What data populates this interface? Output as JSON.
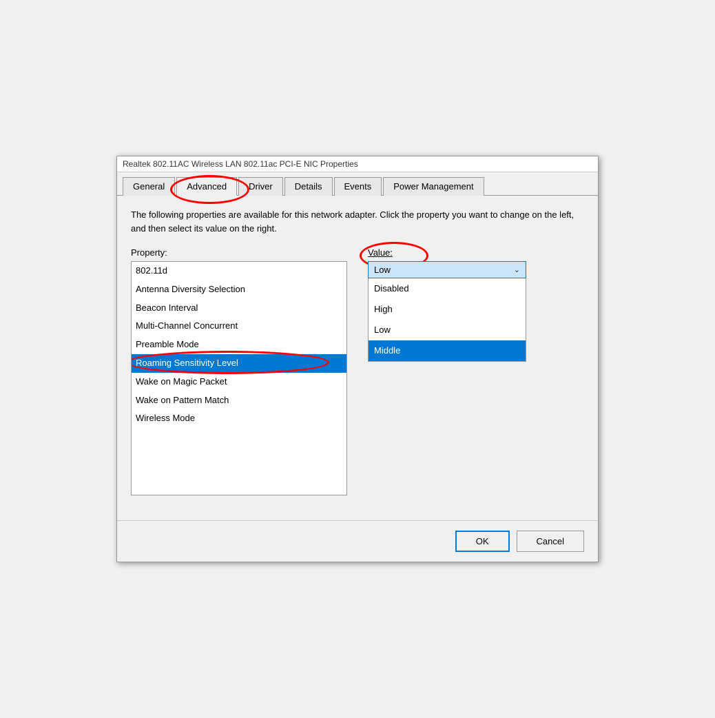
{
  "dialog": {
    "title": "Realtek 802.11AC Wireless LAN 802.11ac PCI-E NIC Properties"
  },
  "tabs": [
    {
      "label": "General",
      "active": false
    },
    {
      "label": "Advanced",
      "active": true
    },
    {
      "label": "Driver",
      "active": false
    },
    {
      "label": "Details",
      "active": false
    },
    {
      "label": "Events",
      "active": false
    },
    {
      "label": "Power Management",
      "active": false
    }
  ],
  "description": "The following properties are available for this network adapter. Click the property you want to change on the left, and then select its value on the right.",
  "property_label": "Property:",
  "value_label": "Value:",
  "properties": [
    {
      "name": "802.11d",
      "selected": false
    },
    {
      "name": "Antenna Diversity Selection",
      "selected": false
    },
    {
      "name": "Beacon Interval",
      "selected": false
    },
    {
      "name": "Multi-Channel Concurrent",
      "selected": false
    },
    {
      "name": "Preamble Mode",
      "selected": false
    },
    {
      "name": "Roaming Sensitivity Level",
      "selected": true
    },
    {
      "name": "Wake on Magic Packet",
      "selected": false
    },
    {
      "name": "Wake on Pattern Match",
      "selected": false
    },
    {
      "name": "Wireless Mode",
      "selected": false
    }
  ],
  "value_dropdown": {
    "selected": "Low",
    "options": [
      {
        "label": "Disabled",
        "selected": false
      },
      {
        "label": "High",
        "selected": false
      },
      {
        "label": "Low",
        "selected": false
      },
      {
        "label": "Middle",
        "selected": true
      }
    ]
  },
  "buttons": {
    "ok": "OK",
    "cancel": "Cancel"
  }
}
